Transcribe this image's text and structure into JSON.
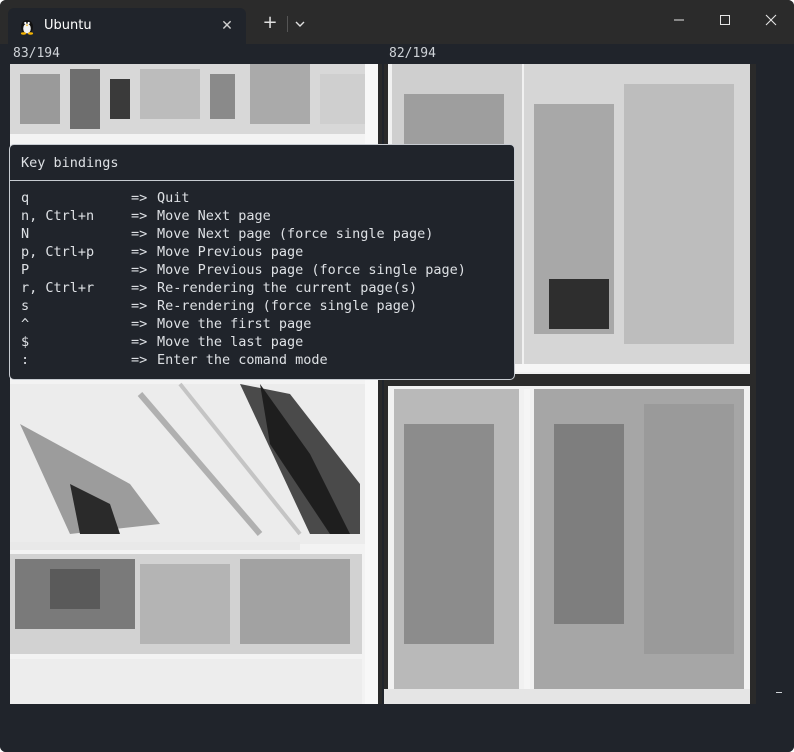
{
  "window": {
    "tab_title": "Ubuntu",
    "tab_icon": "linux-penguin-icon",
    "new_tab_label": "+",
    "close_tab_label": "✕"
  },
  "viewer": {
    "left_page_counter": "83/194",
    "right_page_counter": "82/194"
  },
  "keybindings": {
    "title": "Key bindings",
    "items": [
      {
        "key": "q",
        "arrow": "=>",
        "action": "Quit"
      },
      {
        "key": "n, Ctrl+n",
        "arrow": "=>",
        "action": "Move Next page"
      },
      {
        "key": "N",
        "arrow": "=>",
        "action": "Move Next page (force single page)"
      },
      {
        "key": "p, Ctrl+p",
        "arrow": "=>",
        "action": "Move Previous page"
      },
      {
        "key": "P",
        "arrow": "=>",
        "action": "Move Previous page (force single page)"
      },
      {
        "key": "r, Ctrl+r",
        "arrow": "=>",
        "action": "Re-rendering the current page(s)"
      },
      {
        "key": "s",
        "arrow": "=>",
        "action": "Re-rendering (force single page)"
      },
      {
        "key": "^",
        "arrow": "=>",
        "action": "Move the first page"
      },
      {
        "key": "$",
        "arrow": "=>",
        "action": "Move the last page"
      },
      {
        "key": ":",
        "arrow": "=>",
        "action": "Enter the comand mode"
      }
    ]
  },
  "colors": {
    "terminal_bg": "#20242b",
    "titlebar_bg": "#2b2b2b",
    "text": "#dde0e4",
    "border": "#c7cbd1"
  }
}
